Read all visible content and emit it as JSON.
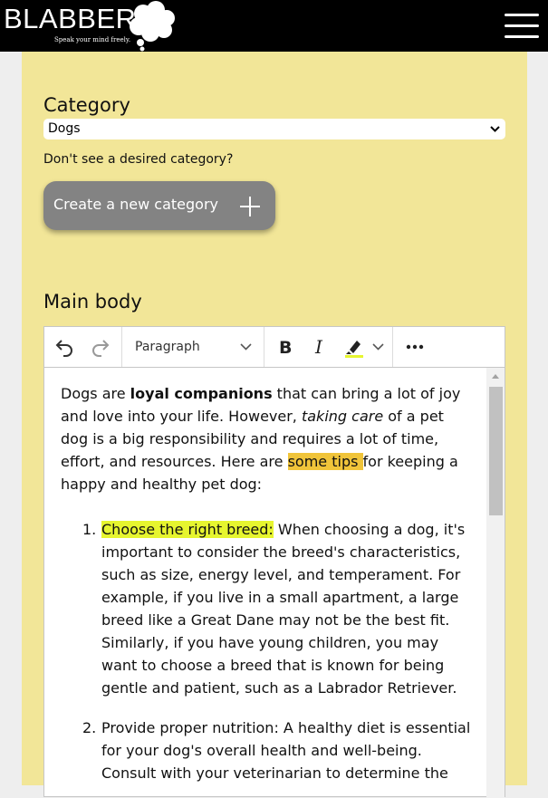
{
  "header": {
    "brand": "BLABBER",
    "tagline": "Speak your mind freely."
  },
  "form": {
    "category_heading": "Category",
    "category_selected": "Dogs",
    "category_hint": "Don't see a desired category?",
    "create_category_label": "Create a new category",
    "main_body_heading": "Main body"
  },
  "editor": {
    "block_style": "Paragraph",
    "intro": {
      "t1": "Dogs are ",
      "b1": "loyal companions",
      "t2": " that can bring a lot of joy and love into your life. However, ",
      "i1": "taking care",
      "t3": " of a pet dog is a big responsibility and requires a lot of time, effort, and resources. Here are ",
      "h1": "some tips ",
      "t4": "for keeping a happy and healthy pet dog:"
    },
    "items": [
      {
        "num": "1.",
        "highlight": "Choose the right breed:",
        "text": " When choosing a dog, it's important to consider the breed's characteristics, such as size, energy level, and temperament. For example, if you live in a small apartment, a large breed like a Great Dane may not be the best fit. Similarly, if you have young children, you may want to choose a breed that is known for being gentle and patient, such as a Labrador Retriever."
      },
      {
        "num": "2.",
        "highlight": "",
        "text": "Provide proper nutrition: A healthy diet is essential for your dog's overall health and well-being. Consult with your veterinarian to determine the"
      }
    ]
  },
  "colors": {
    "panel": "#f2e698",
    "topbar": "#000000",
    "highlight_orange": "#f0c43a",
    "highlight_yellow": "#e6f52f",
    "create_button": "#838383"
  },
  "icons": [
    "cloud-logo-icon",
    "hamburger-menu-icon",
    "chevron-down-icon",
    "plus-icon",
    "undo-icon",
    "redo-icon",
    "bold-icon",
    "italic-icon",
    "highlight-pen-icon",
    "more-options-icon",
    "scroll-up-arrow-icon"
  ]
}
